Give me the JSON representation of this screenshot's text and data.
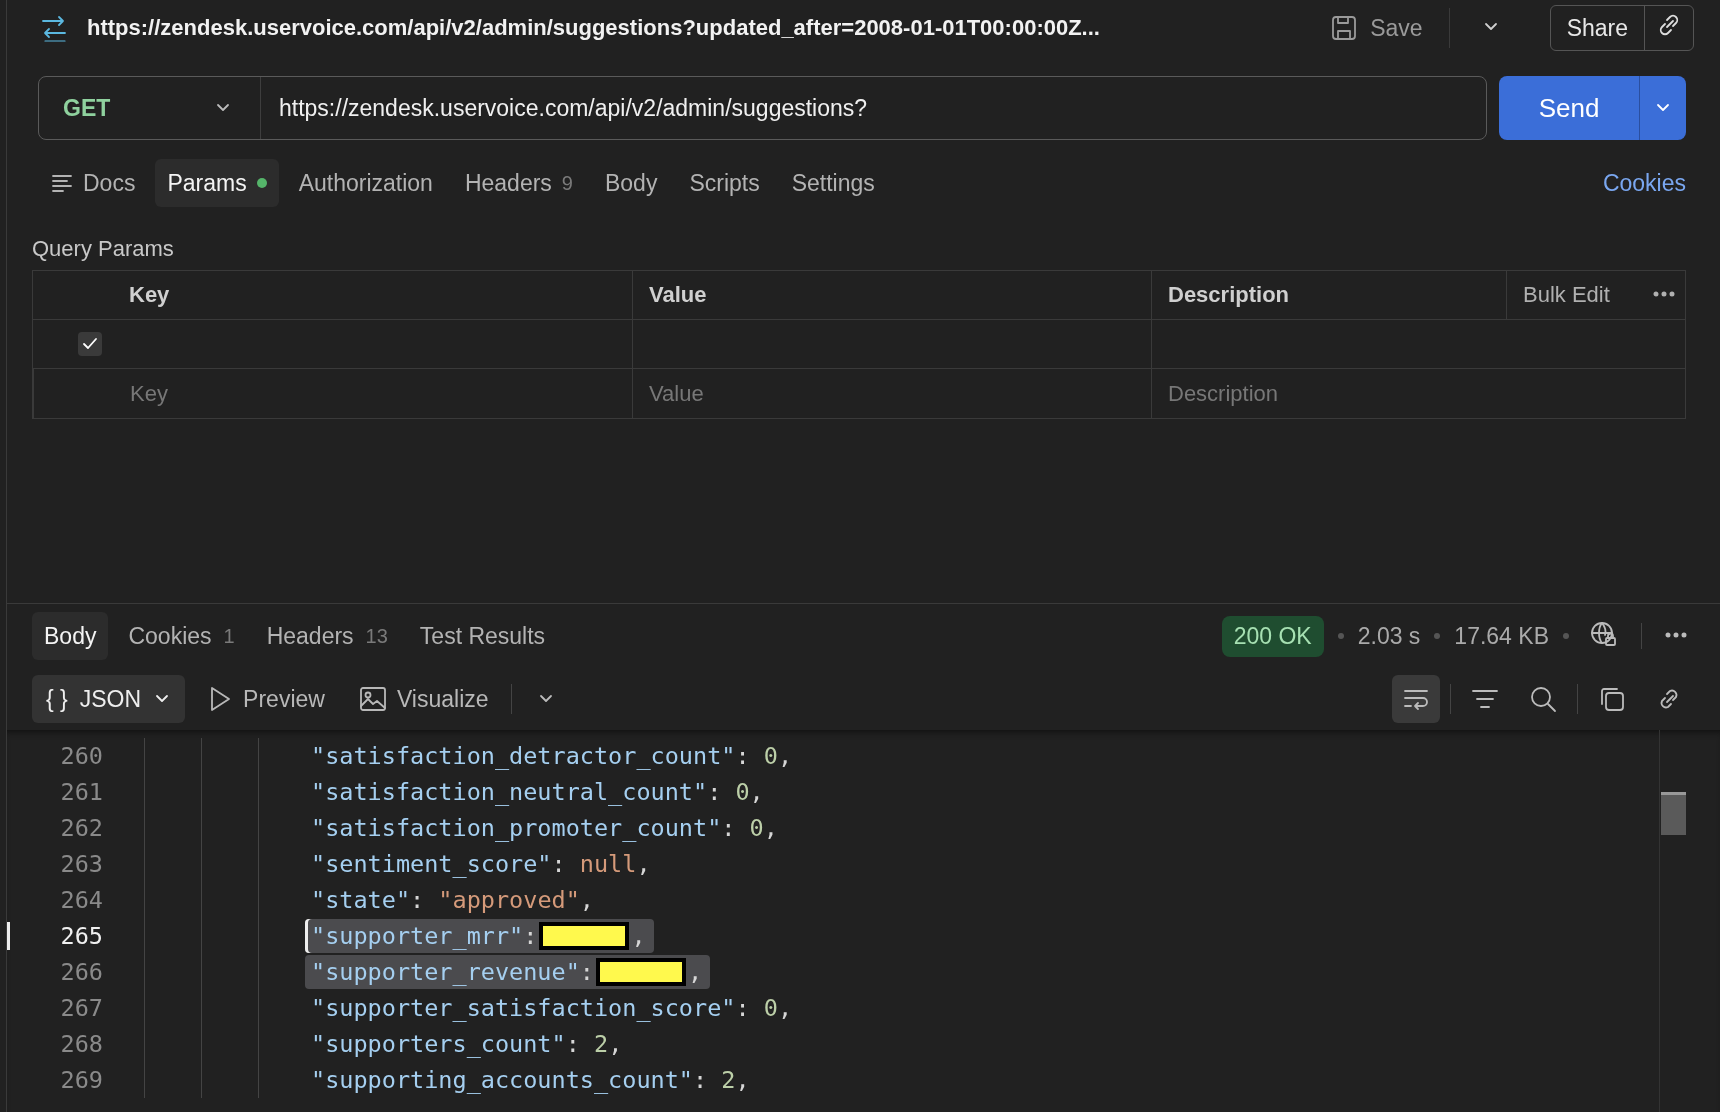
{
  "request_title": "https://zendesk.uservoice.com/api/v2/admin/suggestions?updated_after=2008-01-01T00:00:00Z...",
  "toolbar": {
    "save": "Save",
    "share": "Share"
  },
  "method": "GET",
  "url": "https://zendesk.uservoice.com/api/v2/admin/suggestions?",
  "send": "Send",
  "request_tabs": [
    {
      "kind": "docs",
      "label": "Docs",
      "selected": false,
      "dot": false
    },
    {
      "kind": "tab",
      "label": "Params",
      "selected": true,
      "dot": true
    },
    {
      "kind": "tab",
      "label": "Authorization",
      "selected": false,
      "dot": false
    },
    {
      "kind": "tab",
      "label": "Headers",
      "count": "9",
      "selected": false,
      "dot": false
    },
    {
      "kind": "tab",
      "label": "Body",
      "selected": false,
      "dot": false
    },
    {
      "kind": "tab",
      "label": "Scripts",
      "selected": false,
      "dot": false
    },
    {
      "kind": "tab",
      "label": "Settings",
      "selected": false,
      "dot": false
    }
  ],
  "cookies_link": "Cookies",
  "query_params": {
    "title": "Query Params",
    "columns": [
      "Key",
      "Value",
      "Description"
    ],
    "bulk_edit": "Bulk Edit",
    "rows": [
      {
        "checked": true
      }
    ],
    "new_row": [
      {
        "placeholder": "Key"
      },
      {
        "placeholder": "Value"
      },
      {
        "placeholder": "Description"
      }
    ]
  },
  "response_tabs": [
    {
      "label": "Body",
      "selected": true
    },
    {
      "label": "Cookies",
      "count": "1",
      "selected": false
    },
    {
      "label": "Headers",
      "count": "13",
      "selected": false
    },
    {
      "label": "Test Results",
      "selected": false
    }
  ],
  "status": {
    "code": "200 OK",
    "time": "2.03 s",
    "size": "17.64 KB"
  },
  "format": {
    "icon": "{ }",
    "label": "JSON"
  },
  "views": [
    {
      "kind": "preview",
      "label": "Preview"
    },
    {
      "kind": "visualize",
      "label": "Visualize"
    }
  ],
  "wrap_lines": true,
  "code_lines": [
    {
      "number": "260",
      "selected": false,
      "cursor": false,
      "tokens": [
        {
          "kind": "key",
          "text": "\"satisfaction_detractor_count\""
        },
        {
          "kind": "punct",
          "text": ": "
        },
        {
          "kind": "number",
          "text": "0"
        },
        {
          "kind": "punct",
          "text": ","
        }
      ]
    },
    {
      "number": "261",
      "selected": false,
      "cursor": false,
      "tokens": [
        {
          "kind": "key",
          "text": "\"satisfaction_neutral_count\""
        },
        {
          "kind": "punct",
          "text": ": "
        },
        {
          "kind": "number",
          "text": "0"
        },
        {
          "kind": "punct",
          "text": ","
        }
      ]
    },
    {
      "number": "262",
      "selected": false,
      "cursor": false,
      "tokens": [
        {
          "kind": "key",
          "text": "\"satisfaction_promoter_count\""
        },
        {
          "kind": "punct",
          "text": ": "
        },
        {
          "kind": "number",
          "text": "0"
        },
        {
          "kind": "punct",
          "text": ","
        }
      ]
    },
    {
      "number": "263",
      "selected": false,
      "cursor": false,
      "tokens": [
        {
          "kind": "key",
          "text": "\"sentiment_score\""
        },
        {
          "kind": "punct",
          "text": ": "
        },
        {
          "kind": "string",
          "text": "null"
        },
        {
          "kind": "punct",
          "text": ","
        }
      ]
    },
    {
      "number": "264",
      "selected": false,
      "cursor": false,
      "tokens": [
        {
          "kind": "key",
          "text": "\"state\""
        },
        {
          "kind": "punct",
          "text": ": "
        },
        {
          "kind": "string",
          "text": "\"approved\""
        },
        {
          "kind": "punct",
          "text": ","
        }
      ]
    },
    {
      "number": "265",
      "selected": true,
      "cursor": true,
      "tokens": [
        {
          "kind": "key",
          "text": "\"supporter_mrr\""
        },
        {
          "kind": "punct",
          "text": ":"
        },
        {
          "kind": "redacted"
        },
        {
          "kind": "punct",
          "text": ","
        }
      ]
    },
    {
      "number": "266",
      "selected": true,
      "cursor": false,
      "tokens": [
        {
          "kind": "key",
          "text": "\"supporter_revenue\""
        },
        {
          "kind": "punct",
          "text": ":"
        },
        {
          "kind": "redacted"
        },
        {
          "kind": "punct",
          "text": ","
        }
      ]
    },
    {
      "number": "267",
      "selected": false,
      "cursor": false,
      "tokens": [
        {
          "kind": "key",
          "text": "\"supporter_satisfaction_score\""
        },
        {
          "kind": "punct",
          "text": ": "
        },
        {
          "kind": "number",
          "text": "0"
        },
        {
          "kind": "punct",
          "text": ","
        }
      ]
    },
    {
      "number": "268",
      "selected": false,
      "cursor": false,
      "tokens": [
        {
          "kind": "key",
          "text": "\"supporters_count\""
        },
        {
          "kind": "punct",
          "text": ": "
        },
        {
          "kind": "number",
          "text": "2"
        },
        {
          "kind": "punct",
          "text": ","
        }
      ]
    },
    {
      "number": "269",
      "selected": false,
      "cursor": false,
      "tokens": [
        {
          "kind": "key",
          "text": "\"supporting_accounts_count\""
        },
        {
          "kind": "punct",
          "text": ": "
        },
        {
          "kind": "number",
          "text": "2"
        },
        {
          "kind": "punct",
          "text": ","
        }
      ]
    }
  ]
}
